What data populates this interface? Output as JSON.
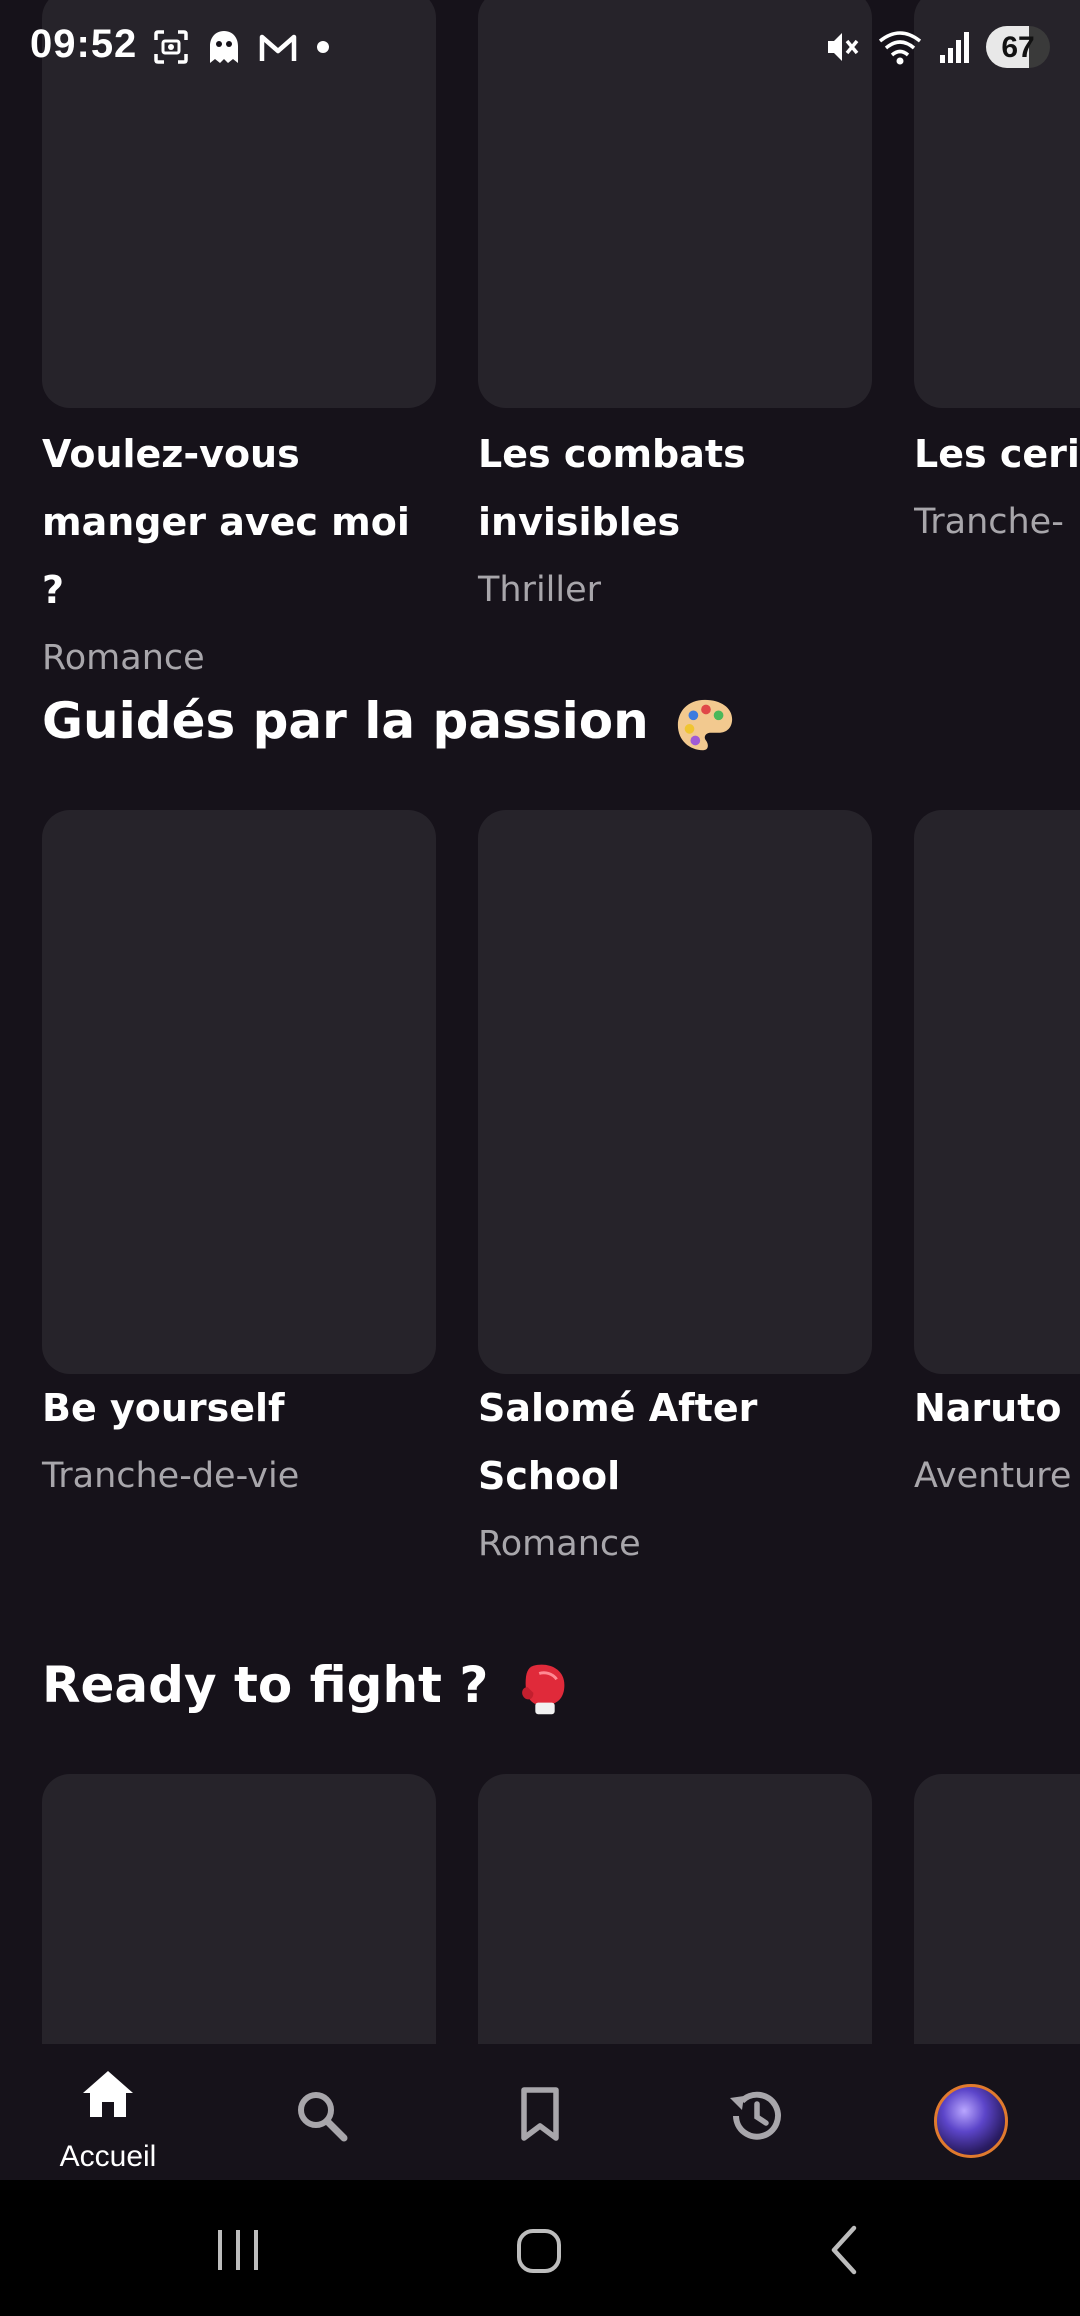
{
  "status_bar": {
    "time": "09:52",
    "battery_level": "67",
    "left_icons": [
      "screenshot-icon",
      "ghost-icon",
      "gmail-icon",
      "dot-icon"
    ],
    "right_icons": [
      "mute-icon",
      "wifi-icon",
      "signal-icon"
    ]
  },
  "sections": [
    {
      "title": "",
      "items": [
        {
          "title": "Voulez-vous manger avec moi ?",
          "genre": "Romance"
        },
        {
          "title": "Les combats invisibles",
          "genre": "Thriller"
        },
        {
          "title": "Les ceris fleurisse",
          "genre": "Tranche-"
        }
      ]
    },
    {
      "title": "Guidés par la passion",
      "emoji": "palette-emoji",
      "items": [
        {
          "title": "Be yourself",
          "genre": "Tranche-de-vie"
        },
        {
          "title": "Salomé After School",
          "genre": "Romance"
        },
        {
          "title": "Naruto",
          "genre": "Aventure"
        }
      ]
    },
    {
      "title": "Ready to fight ?",
      "emoji": "boxing-glove-emoji",
      "items": [
        {},
        {},
        {}
      ]
    }
  ],
  "bottom_nav": {
    "items": [
      {
        "icon": "home-icon",
        "label": "Accueil",
        "active": true
      },
      {
        "icon": "search-icon"
      },
      {
        "icon": "bookmark-icon"
      },
      {
        "icon": "history-icon"
      },
      {
        "icon": "avatar"
      }
    ]
  },
  "system_nav": [
    "recents-icon",
    "home-circle-icon",
    "back-icon"
  ],
  "colors": {
    "background": "#16121a",
    "card": "#26232a",
    "genre_text": "#a8a6ab",
    "avatar_ring": "#e07a2e"
  }
}
